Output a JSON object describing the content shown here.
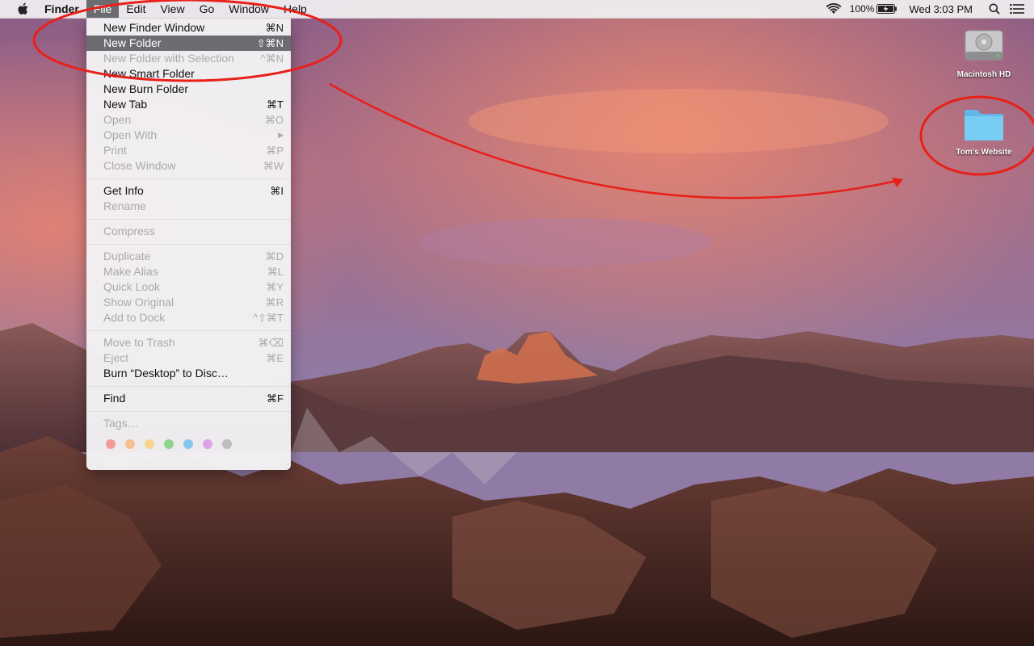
{
  "menubar": {
    "app_name": "Finder",
    "menus": [
      "File",
      "Edit",
      "View",
      "Go",
      "Window",
      "Help"
    ],
    "battery": "100%",
    "clock": "Wed 3:03 PM"
  },
  "file_menu": {
    "items": [
      {
        "label": "New Finder Window",
        "shortcut": "⌘N"
      },
      {
        "label": "New Folder",
        "shortcut": "⇧⌘N"
      },
      {
        "label": "New Folder with Selection",
        "shortcut": "^⌘N"
      },
      {
        "label": "New Smart Folder",
        "shortcut": ""
      },
      {
        "label": "New Burn Folder",
        "shortcut": ""
      },
      {
        "label": "New Tab",
        "shortcut": "⌘T"
      },
      {
        "label": "Open",
        "shortcut": "⌘O"
      },
      {
        "label": "Open With",
        "shortcut": "▶"
      },
      {
        "label": "Print",
        "shortcut": "⌘P"
      },
      {
        "label": "Close Window",
        "shortcut": "⌘W"
      },
      {
        "label": "Get Info",
        "shortcut": "⌘I"
      },
      {
        "label": "Rename",
        "shortcut": ""
      },
      {
        "label": "Compress",
        "shortcut": ""
      },
      {
        "label": "Duplicate",
        "shortcut": "⌘D"
      },
      {
        "label": "Make Alias",
        "shortcut": "⌘L"
      },
      {
        "label": "Quick Look",
        "shortcut": "⌘Y"
      },
      {
        "label": "Show Original",
        "shortcut": "⌘R"
      },
      {
        "label": "Add to Dock",
        "shortcut": "^⇧⌘T"
      },
      {
        "label": "Move to Trash",
        "shortcut": "⌘⌫"
      },
      {
        "label": "Eject",
        "shortcut": "⌘E"
      },
      {
        "label": "Burn “Desktop” to Disc…",
        "shortcut": ""
      },
      {
        "label": "Find",
        "shortcut": "⌘F"
      },
      {
        "label": "Tags…",
        "shortcut": ""
      }
    ],
    "tag_colors": [
      "#f29a9a",
      "#f7be8e",
      "#f8d58f",
      "#8fd48a",
      "#86c6ef",
      "#dda3e6",
      "#bdbdbd"
    ]
  },
  "desktop": {
    "icons": [
      {
        "name": "Macintosh HD"
      },
      {
        "name": "Tom's Website"
      }
    ]
  },
  "colors": {
    "annotation": "#e8201a",
    "highlight": "#6d6c71",
    "folder": "#6cc6f2"
  }
}
